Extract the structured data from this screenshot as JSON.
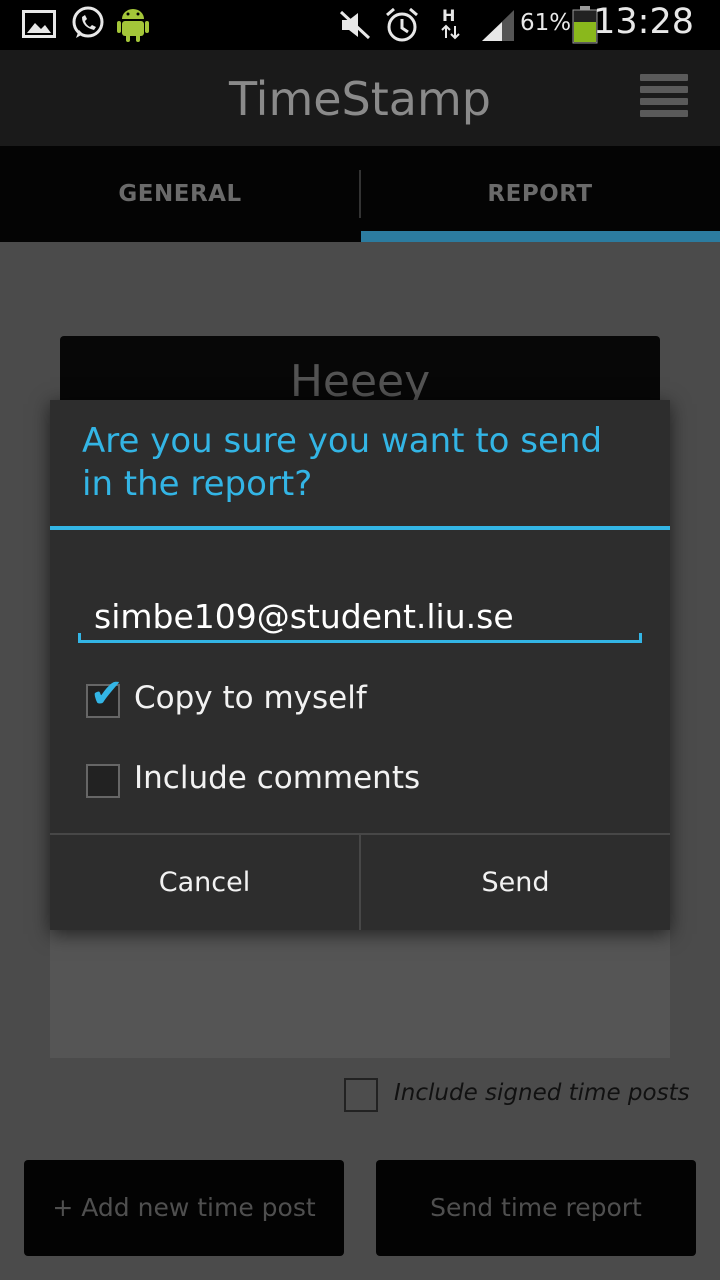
{
  "status_bar": {
    "icons": [
      "gallery-icon",
      "whatsapp-icon",
      "android-icon",
      "mute-icon",
      "alarm-icon",
      "hspa-icon",
      "signal-icon",
      "battery-icon"
    ],
    "battery": "61%",
    "time": "13:28"
  },
  "app_bar": {
    "title": "TimeStamp",
    "menu_icon": "overflow-menu-icon"
  },
  "tabs": [
    {
      "label": "GENERAL",
      "selected": false
    },
    {
      "label": "REPORT",
      "selected": true
    }
  ],
  "report": {
    "title_card": "Heeey",
    "include_signed_label": "Include signed time posts",
    "include_signed_checked": false,
    "add_post_label": "+ Add new time post",
    "send_report_label": "Send time report"
  },
  "dialog": {
    "title": "Are you sure you want to send in the report?",
    "email_value": "simbe109@student.liu.se",
    "copy_label": "Copy to myself",
    "copy_checked": true,
    "comments_label": "Include comments",
    "comments_checked": false,
    "cancel_label": "Cancel",
    "send_label": "Send"
  },
  "colors": {
    "accent": "#33b5e5",
    "tab_indicator": "#2c7ca0",
    "dialog_bg": "#2d2d2d"
  }
}
